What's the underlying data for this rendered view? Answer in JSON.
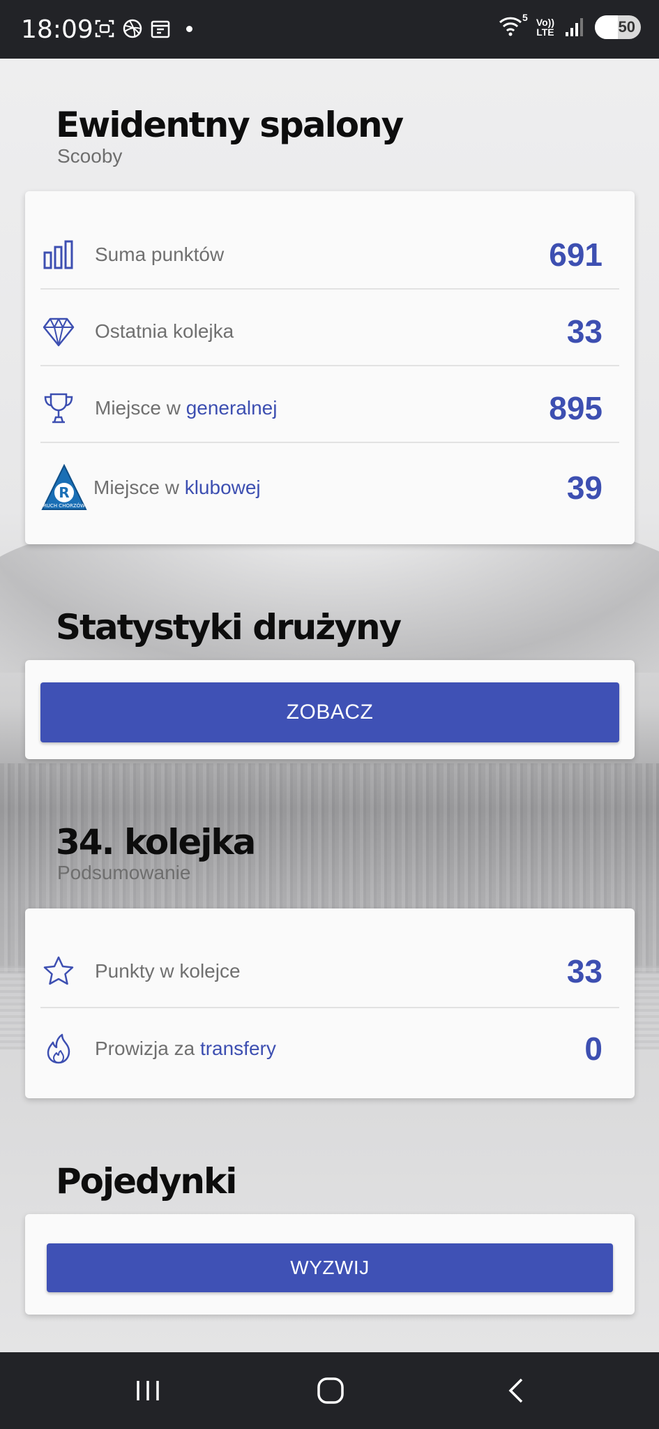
{
  "status_bar": {
    "time": "18:09",
    "icons_left": [
      "screenshot-icon",
      "dribbble-icon",
      "calendar-icon",
      "notification-dot"
    ],
    "icons_right": [
      "wifi-5-icon",
      "volte-icon",
      "signal-icon",
      "battery-icon"
    ],
    "wifi_label": "5",
    "volte_top": "Vo))",
    "volte_bottom": "LTE",
    "battery_level": "50"
  },
  "header": {
    "title": "Ewidentny spalony",
    "subtitle": "Scooby"
  },
  "summary": {
    "rows": [
      {
        "icon": "bar-chart-icon",
        "label": "Suma punktów",
        "label_highlight": "",
        "value": "691"
      },
      {
        "icon": "diamond-icon",
        "label": "Ostatnia kolejka",
        "label_highlight": "",
        "value": "33"
      },
      {
        "icon": "trophy-icon",
        "label": "Miejsce w ",
        "label_highlight": "generalnej",
        "value": "895"
      },
      {
        "icon": "club-crest-icon",
        "label": "Miejsce w ",
        "label_highlight": "klubowej",
        "value": "39"
      }
    ],
    "crest_text": "RUCH CHORZÓW"
  },
  "team_stats": {
    "title": "Statystyki drużyny",
    "button": "ZOBACZ"
  },
  "round": {
    "title": "34. kolejka",
    "subtitle": "Podsumowanie",
    "rows": [
      {
        "icon": "star-icon",
        "label": "Punkty w kolejce",
        "label_highlight": "",
        "value": "33"
      },
      {
        "icon": "flame-icon",
        "label": "Prowizja za ",
        "label_highlight": "transfery",
        "value": "0"
      }
    ]
  },
  "duels": {
    "title": "Pojedynki",
    "button": "WYZWIJ"
  },
  "colors": {
    "accent": "#3f51b5",
    "value_text": "#3d4fb1",
    "bars": "#222327"
  }
}
